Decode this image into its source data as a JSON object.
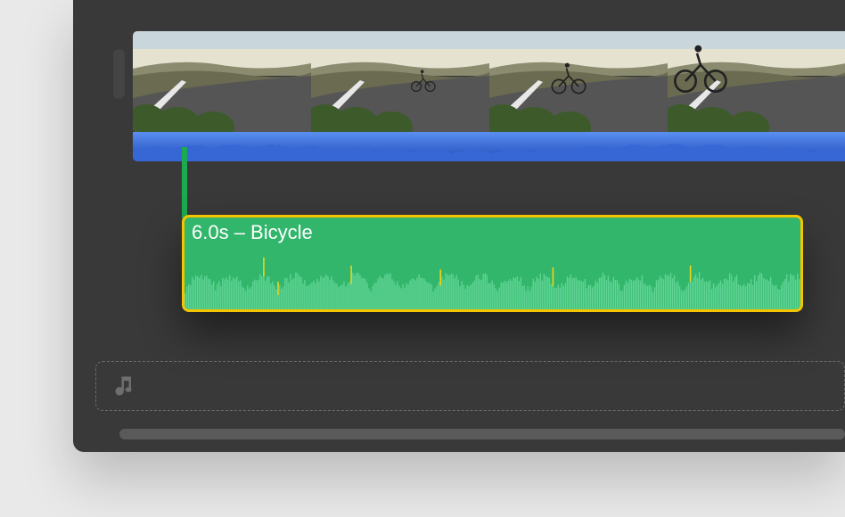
{
  "timeline": {
    "video_clip": {
      "frame_count": 4,
      "scene": "cyclist-on-road"
    },
    "audio_clip": {
      "duration_seconds": 6.0,
      "name": "Bicycle",
      "label": "6.0s – Bicycle",
      "selected": true,
      "fill_color": "#32b66b",
      "selection_color": "#f2c500"
    },
    "video_audio_track": {
      "color": "#2a5dd4"
    },
    "music_track": {
      "empty": true,
      "icon": "music-note"
    }
  }
}
